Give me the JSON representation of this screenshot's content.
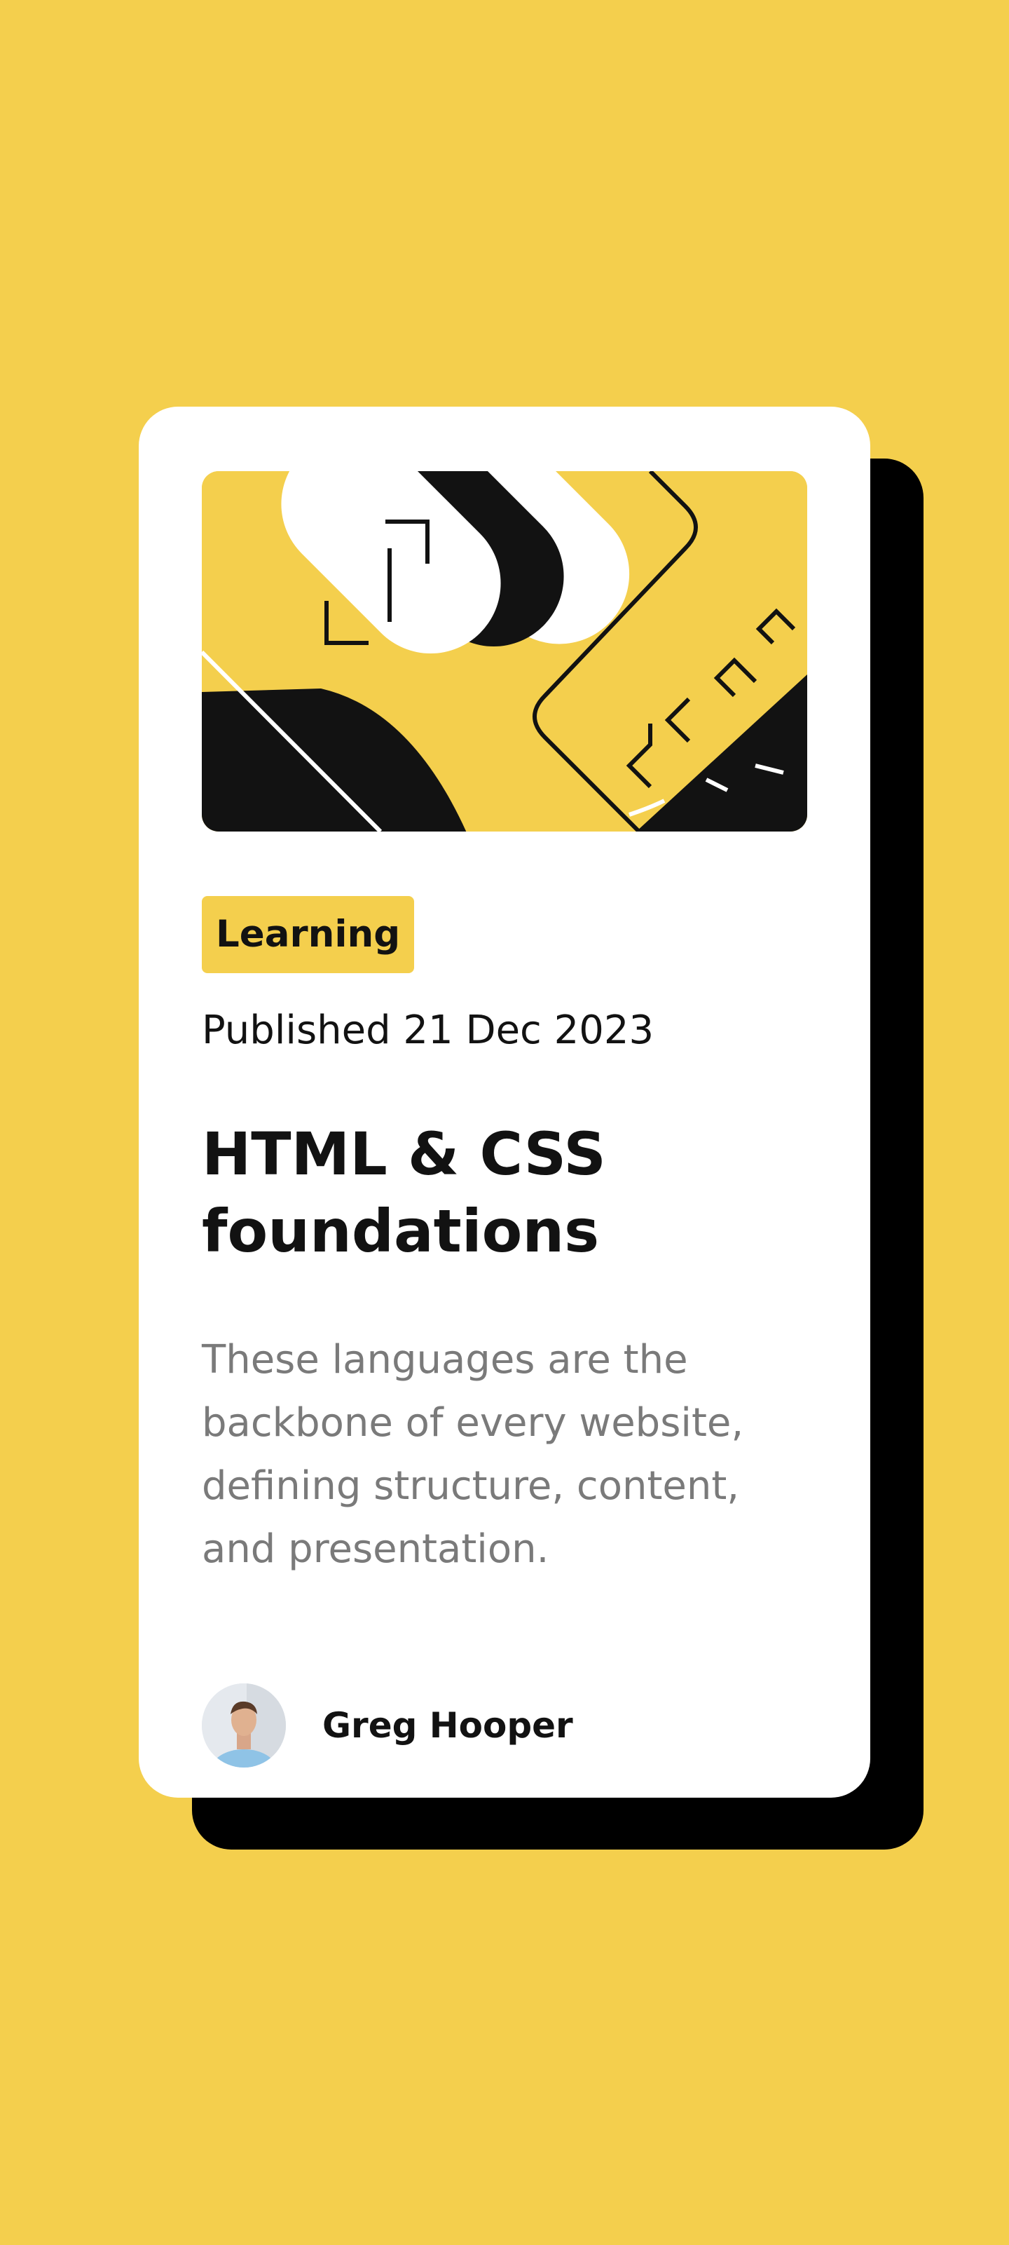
{
  "card": {
    "tag": "Learning",
    "published": "Published 21 Dec 2023",
    "title": "HTML & CSS foundations",
    "description": "These languages are the backbone of every website, defining structure, content, and presentation.",
    "author_name": "Greg Hooper"
  },
  "colors": {
    "background": "#F4CF4D",
    "card": "#FFFFFF",
    "text_primary": "#121212",
    "text_secondary": "#7A7A7A",
    "shadow": "#000000"
  },
  "images": {
    "hero": "illustration-article",
    "avatar": "image-avatar"
  }
}
